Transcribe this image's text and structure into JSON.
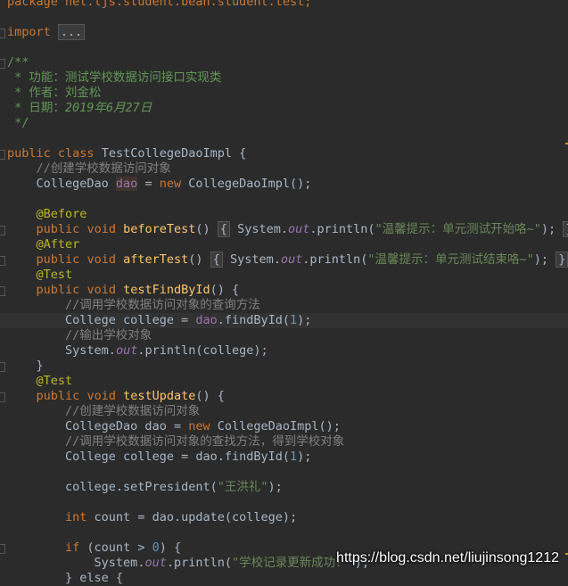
{
  "code": {
    "package": "package net.ljs.student.bean.student.test;",
    "import_kw": "import",
    "import_fold": "...",
    "doc_open": "/**",
    "doc_func": " * 功能：测试学校数据访问接口实现类",
    "doc_author": " * 作者：刘金松",
    "doc_date_prefix": " * 日期：",
    "doc_date": "2019年6月27日",
    "doc_close": " */",
    "class_public": "public",
    "class_kw": "class",
    "class_name": "TestCollegeDaoImpl {",
    "comment_create": "//创建学校数据访问对象",
    "field_type": "CollegeDao ",
    "field_name": "dao",
    "field_assign": " = ",
    "new_kw": "new",
    "field_ctor": " CollegeDaoImpl();",
    "ann_before": "@Before",
    "ann_after": "@After",
    "ann_test": "@Test",
    "public": "public",
    "void": "void",
    "before_name": "beforeTest",
    "after_name": "afterTest",
    "find_name": "testFindById",
    "update_name": "testUpdate",
    "parens": "()",
    "open_brace": " {",
    "fold_open": "{",
    "fold_close": "}",
    "system": "System.",
    "out": "out",
    "println_open": ".println(",
    "str_before": "\"温馨提示：单元测试开始咯~\"",
    "str_after": "\"温馨提示：单元测试结束咯~\"",
    "close_stmt": ");",
    "comment_find_query": "//调用学校数据访问对象的查询方法",
    "college_decl": "College college = ",
    "dao_find_prefix": "dao",
    "find_call": ".findById(",
    "num_1": "1",
    "comment_output": "//输出学校对象",
    "println_college": "System.out.println(college);",
    "close_brace": "}",
    "update_create_type": "CollegeDao dao = ",
    "update_ctor": " CollegeDaoImpl();",
    "comment_find_method": "//调用学校数据访问对象的查找方法，得到学校对象",
    "college_find_plain": "College college = dao.findById(",
    "set_president": "college.setPresident(",
    "str_president": "\"王洪礼\"",
    "int_kw": "int",
    "count_decl": " count = dao.update(college);",
    "if_kw": "if",
    "if_cond_open": " (count > ",
    "num_0": "0",
    "if_cond_close": ") {",
    "str_success": "\"学校记录更新成功！\"",
    "partial_last": "} else {"
  },
  "watermark": "https://blog.csdn.net/liujinsong1212",
  "colors": {
    "background": "#2b2b2b",
    "keyword": "#cc7832",
    "string": "#6a8759",
    "annotation": "#bbb529",
    "method": "#ffc66d",
    "number": "#6897bb",
    "field": "#9876aa",
    "comment": "#808080",
    "doc": "#629755"
  }
}
